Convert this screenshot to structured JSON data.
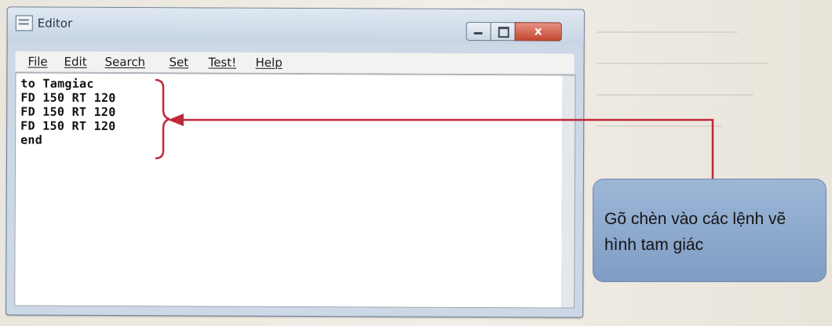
{
  "window": {
    "title": "Editor",
    "controls": {
      "close_glyph": "x"
    }
  },
  "menu": [
    {
      "label": "File"
    },
    {
      "label": "Edit"
    },
    {
      "label": "Search"
    },
    {
      "label": "Set"
    },
    {
      "label": "Test!"
    },
    {
      "label": "Help"
    }
  ],
  "editor": {
    "lines": [
      "to Tamgiac",
      "FD 150 RT 120",
      "FD 150 RT 120",
      "FD 150 RT 120",
      "end"
    ]
  },
  "annotation": {
    "text": "Gõ chèn vào các lệnh vẽ hình tam giác",
    "color": "#c0283a",
    "box_color": "#8fa9cd"
  }
}
